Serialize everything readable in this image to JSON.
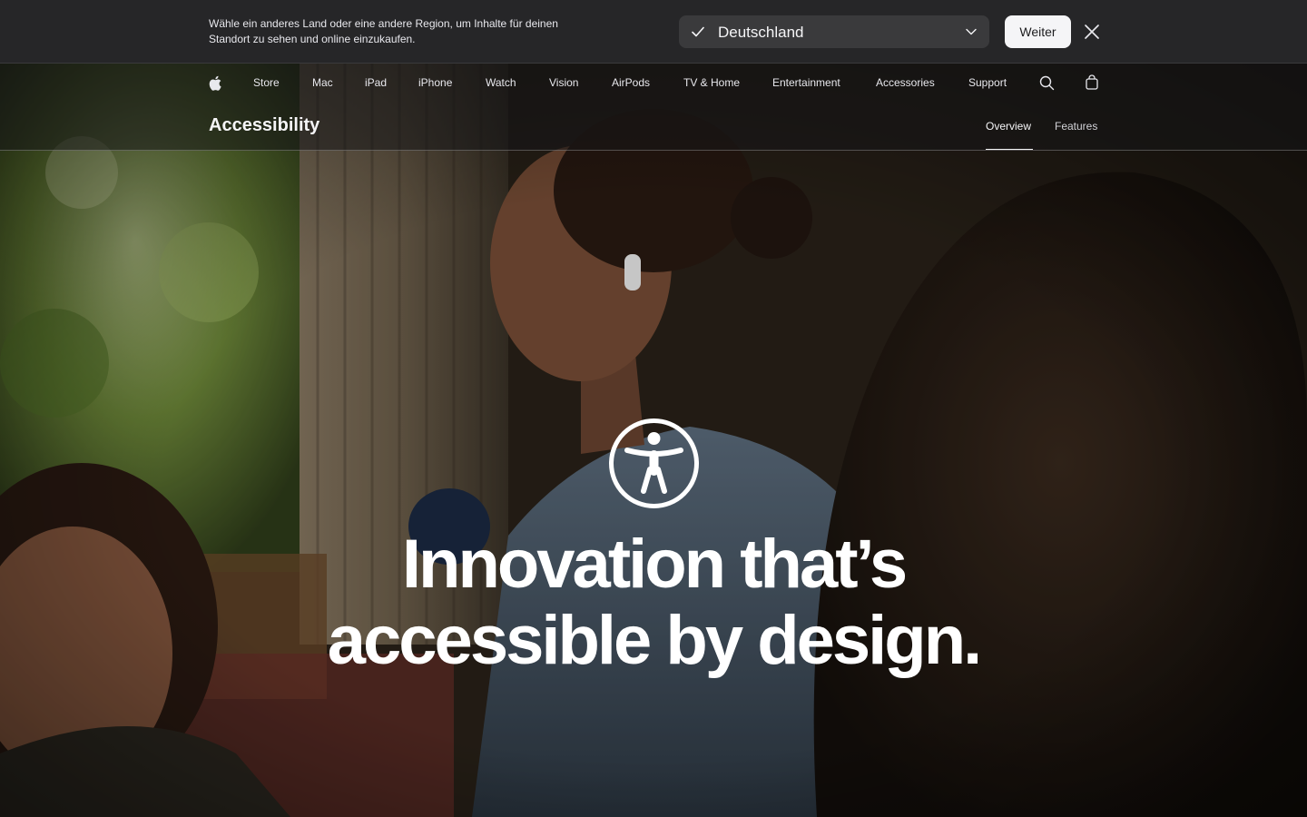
{
  "locale_banner": {
    "message_line1": "Wähle ein anderes Land oder eine andere Region, um Inhalte für deinen",
    "message_line2": "Standort zu sehen und online einzukaufen.",
    "selected_country": "Deutschland",
    "continue_label": "Weiter"
  },
  "globalnav": {
    "items": [
      "Store",
      "Mac",
      "iPad",
      "iPhone",
      "Watch",
      "Vision",
      "AirPods",
      "TV & Home",
      "Entertainment",
      "Accessories",
      "Support"
    ]
  },
  "localnav": {
    "title": "Accessibility",
    "links": [
      "Overview",
      "Features"
    ],
    "active": "Overview"
  },
  "hero": {
    "headline_line1": "Innovation that’s",
    "headline_line2": "accessible by design."
  },
  "icons": {
    "logo": "apple-logo-icon",
    "search": "search-icon",
    "bag": "bag-icon",
    "close": "close-icon",
    "check": "checkmark-icon",
    "chevron": "chevron-down-icon",
    "accessibility": "accessibility-icon"
  }
}
